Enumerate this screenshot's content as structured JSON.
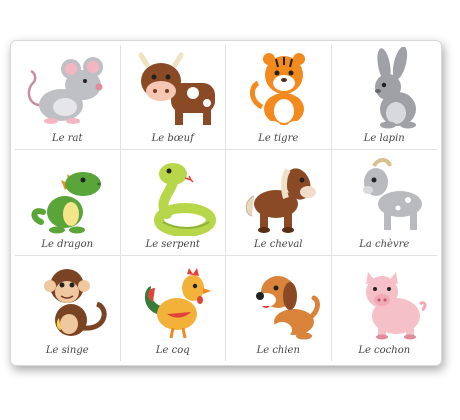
{
  "animals": [
    {
      "label": "Le rat",
      "icon": "rat-icon"
    },
    {
      "label": "Le bœuf",
      "icon": "ox-icon"
    },
    {
      "label": "Le tigre",
      "icon": "tiger-icon"
    },
    {
      "label": "Le lapin",
      "icon": "rabbit-icon"
    },
    {
      "label": "Le dragon",
      "icon": "dragon-icon"
    },
    {
      "label": "Le serpent",
      "icon": "snake-icon"
    },
    {
      "label": "Le cheval",
      "icon": "horse-icon"
    },
    {
      "label": "La chèvre",
      "icon": "goat-icon"
    },
    {
      "label": "Le singe",
      "icon": "monkey-icon"
    },
    {
      "label": "Le coq",
      "icon": "rooster-icon"
    },
    {
      "label": "Le chien",
      "icon": "dog-icon"
    },
    {
      "label": "Le cochon",
      "icon": "pig-icon"
    }
  ]
}
